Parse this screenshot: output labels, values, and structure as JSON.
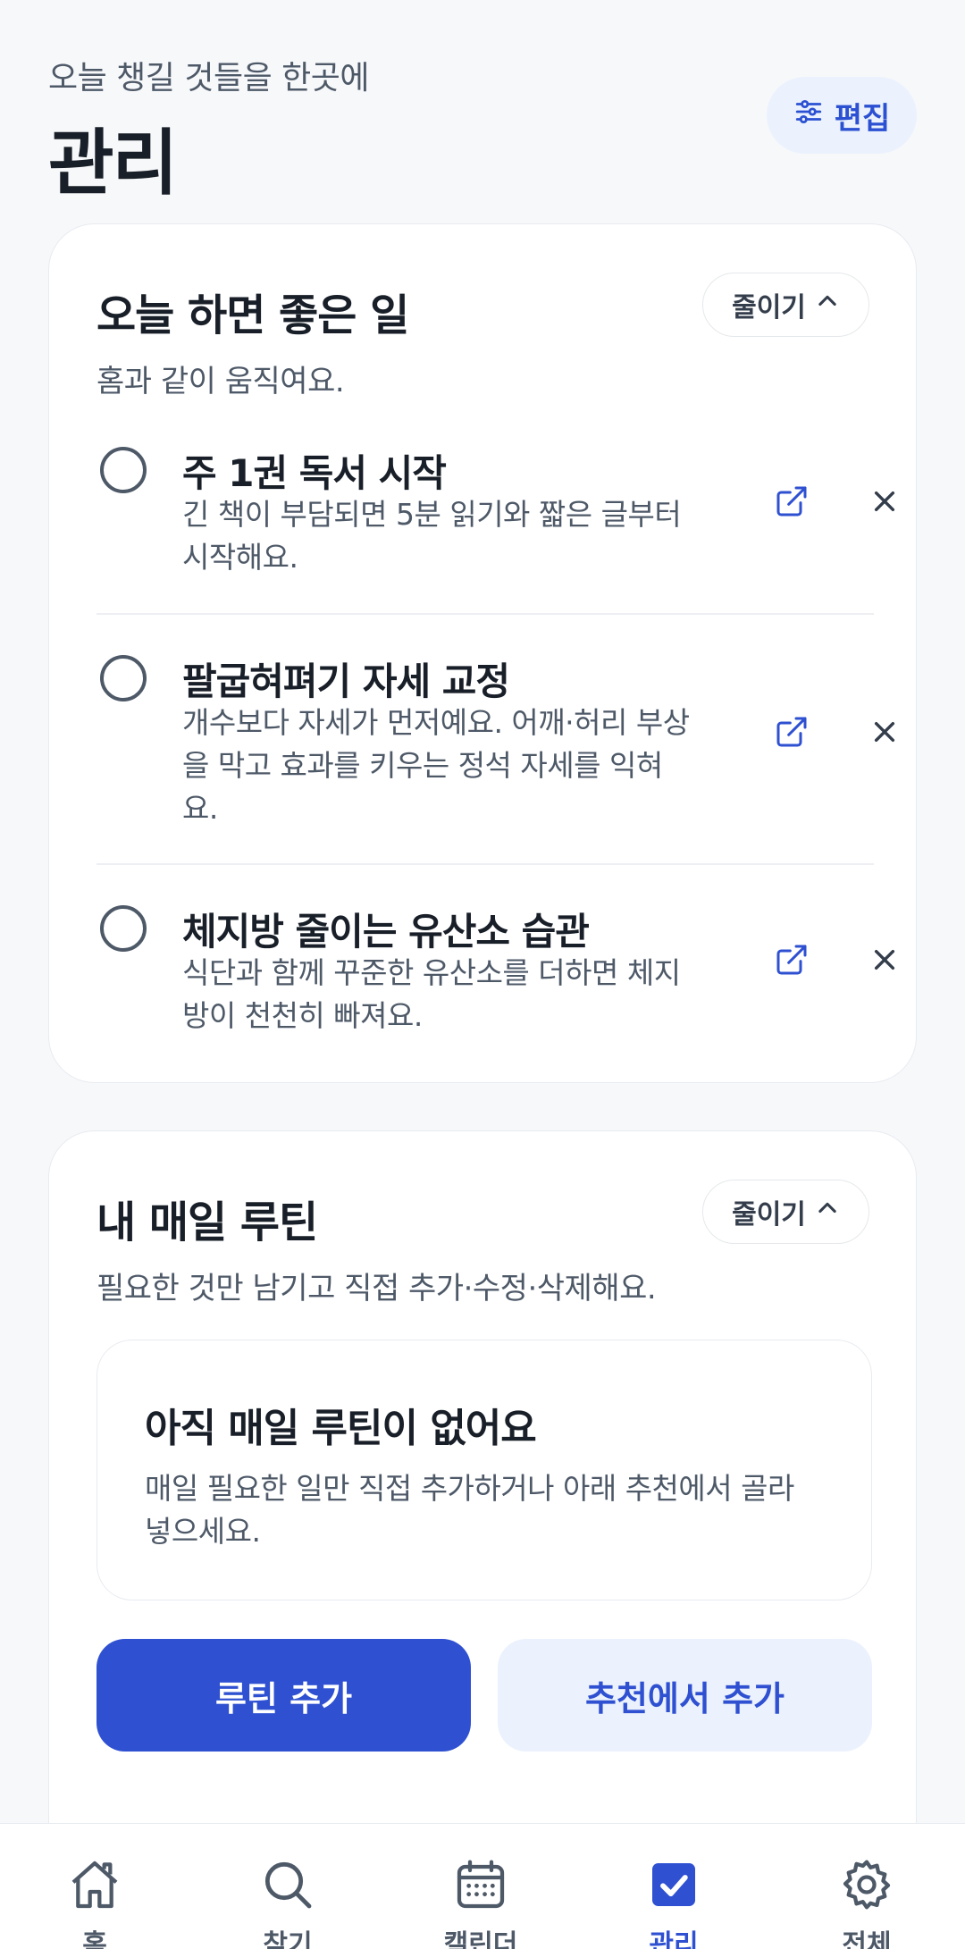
{
  "header": {
    "subtitle": "오늘 챙길 것들을 한곳에",
    "title": "관리",
    "edit_label": "편집"
  },
  "today_card": {
    "title": "오늘 하면 좋은 일",
    "subtitle": "홈과 같이 움직여요.",
    "collapse_label": "줄이기",
    "tasks": [
      {
        "title": "주 1권 독서 시작",
        "description": "긴 책이 부담되면 5분 읽기와 짧은 글부터 시작해요."
      },
      {
        "title": "팔굽혀펴기 자세 교정",
        "description": "개수보다 자세가 먼저예요. 어깨·허리 부상을 막고 효과를 키우는 정석 자세를 익혀요."
      },
      {
        "title": "체지방 줄이는 유산소 습관",
        "description": "식단과 함께 꾸준한 유산소를 더하면 체지방이 천천히 빠져요."
      }
    ]
  },
  "routine_card": {
    "title": "내 매일 루틴",
    "subtitle": "필요한 것만 남기고 직접 추가·수정·삭제해요.",
    "collapse_label": "줄이기",
    "empty_title": "아직 매일 루틴이 없어요",
    "empty_description": "매일 필요한 일만 직접 추가하거나 아래 추천에서 골라 넣으세요.",
    "add_label": "루틴 추가",
    "add_from_recommend_label": "추천에서 추가"
  },
  "bottom_nav": {
    "items": [
      {
        "label": "홈",
        "icon": "home-icon",
        "active": false
      },
      {
        "label": "찾기",
        "icon": "search-icon",
        "active": false
      },
      {
        "label": "캘린더",
        "icon": "calendar-icon",
        "active": false
      },
      {
        "label": "관리",
        "icon": "checkbox-icon",
        "active": true
      },
      {
        "label": "전체",
        "icon": "gear-icon",
        "active": false
      }
    ]
  },
  "colors": {
    "accent": "#2e50d1",
    "accent_light": "#ebf2fd",
    "background": "#f7f8fa",
    "text_primary": "#191f28",
    "text_secondary": "#4e5968"
  }
}
